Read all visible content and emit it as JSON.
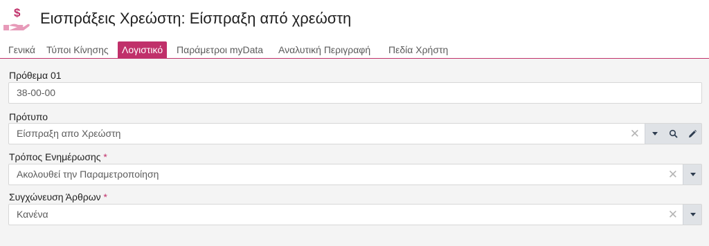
{
  "header": {
    "title": "Εισπράξεις Χρεώστη: Είσπραξη από χρεώστη",
    "icon": "hand-money-icon",
    "icon_color": "#e79ab9"
  },
  "tabs": [
    {
      "label": "Γενικά",
      "active": false
    },
    {
      "label": "Τύποι Κίνησης",
      "active": false
    },
    {
      "label": "Λογιστικό",
      "active": true
    },
    {
      "label": "Παράμετροι myData",
      "active": false
    },
    {
      "label": "Αναλυτική Περιγραφή",
      "active": false
    },
    {
      "label": "Πεδία Χρήστη",
      "active": false
    }
  ],
  "accent_color": "#c0306a",
  "fields": {
    "prefix": {
      "label": "Πρόθεμα 01",
      "value": "38-00-00"
    },
    "template": {
      "label": "Πρότυπο",
      "value": "Είσπραξη απο Χρεώστη",
      "clear": "✕"
    },
    "update_mode": {
      "label": "Τρόπος Ενημέρωσης",
      "required_mark": "*",
      "value": "Ακολουθεί την Παραμετροποίηση",
      "clear": "✕"
    },
    "merge_entries": {
      "label": "Συγχώνευση Άρθρων",
      "required_mark": "*",
      "value": "Κανένα",
      "clear": "✕"
    }
  }
}
